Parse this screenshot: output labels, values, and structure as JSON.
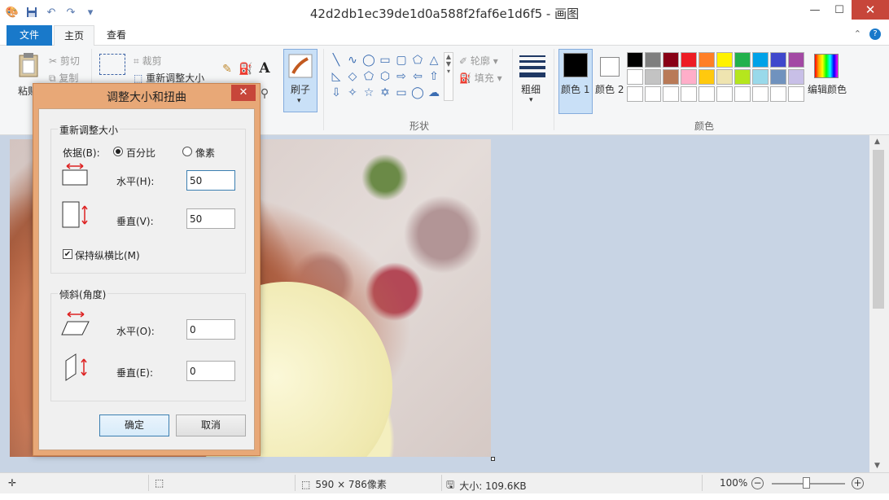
{
  "window": {
    "title": "42d2db1ec39de1d0a588f2faf6e1d6f5 - 画图"
  },
  "ribbon": {
    "tabs": {
      "file": "文件",
      "home": "主页",
      "view": "查看"
    },
    "clipboard": {
      "paste": "粘贴",
      "cut": "剪切",
      "copy": "复制"
    },
    "image": {
      "crop": "裁剪",
      "resize": "重新调整大小"
    },
    "brushes": {
      "label": "刷子"
    },
    "shapes": {
      "outline": "轮廓",
      "fill": "填充",
      "group_label": "形状"
    },
    "size": {
      "label": "粗细"
    },
    "colors": {
      "color1": "颜色 1",
      "color2": "颜色 2",
      "edit": "编辑颜色",
      "group_label": "颜色",
      "color1_value": "#000000",
      "color2_value": "#ffffff",
      "palette_row1": [
        "#000000",
        "#7f7f7f",
        "#880015",
        "#ed1c24",
        "#ff7f27",
        "#fff200",
        "#22b14c",
        "#00a2e8",
        "#3f48cc",
        "#a349a4"
      ],
      "palette_row2": [
        "#ffffff",
        "#c3c3c3",
        "#b97a57",
        "#ffaec9",
        "#ffc90e",
        "#efe4b0",
        "#b5e61d",
        "#99d9ea",
        "#7092be",
        "#c8bfe7"
      ]
    }
  },
  "dialog": {
    "title": "调整大小和扭曲",
    "resize": {
      "legend": "重新调整大小",
      "by_label": "依据(B):",
      "percent_label": "百分比",
      "pixels_label": "像素",
      "selected": "percent",
      "horizontal_label": "水平(H):",
      "horizontal_value": "50",
      "vertical_label": "垂直(V):",
      "vertical_value": "50",
      "keep_ratio_label": "保持纵横比(M)",
      "keep_ratio_checked": true
    },
    "skew": {
      "legend": "倾斜(角度)",
      "horizontal_label": "水平(O):",
      "horizontal_value": "0",
      "vertical_label": "垂直(E):",
      "vertical_value": "0"
    },
    "ok_label": "确定",
    "cancel_label": "取消"
  },
  "status": {
    "image_size": "590 × 786像素",
    "file_size": "大小: 109.6KB",
    "zoom": "100%"
  }
}
